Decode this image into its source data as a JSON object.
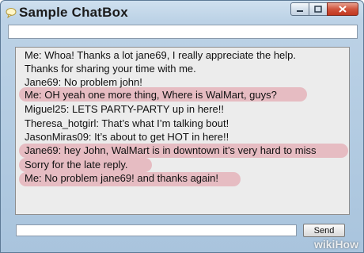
{
  "window": {
    "title": "Sample ChatBox",
    "top_input_value": ""
  },
  "chat": {
    "messages": [
      "Me: Whoa! Thanks a lot jane69, I really appreciate the help.",
      "Thanks for sharing your time with me.",
      "Jane69: No problem john!",
      "Me: OH yeah one more thing, Where is WalMart, guys?",
      "Miguel25: LETS PARTY-PARTY up in here!!",
      "Theresa_hotgirl: That’s what I’m talking bout!",
      "JasonMiras09: It’s about to get HOT in here!!",
      "Jane69: hey John, WalMart is in downtown it’s very hard to miss",
      "Sorry for the late reply.",
      "Me: No problem jane69! and thanks again!"
    ]
  },
  "composer": {
    "input_value": "",
    "send_label": "Send"
  },
  "watermark": "wikiHow",
  "colors": {
    "highlight": "#de6e7d",
    "titlebar": "#bcd2e6",
    "close_button": "#c2371f"
  }
}
